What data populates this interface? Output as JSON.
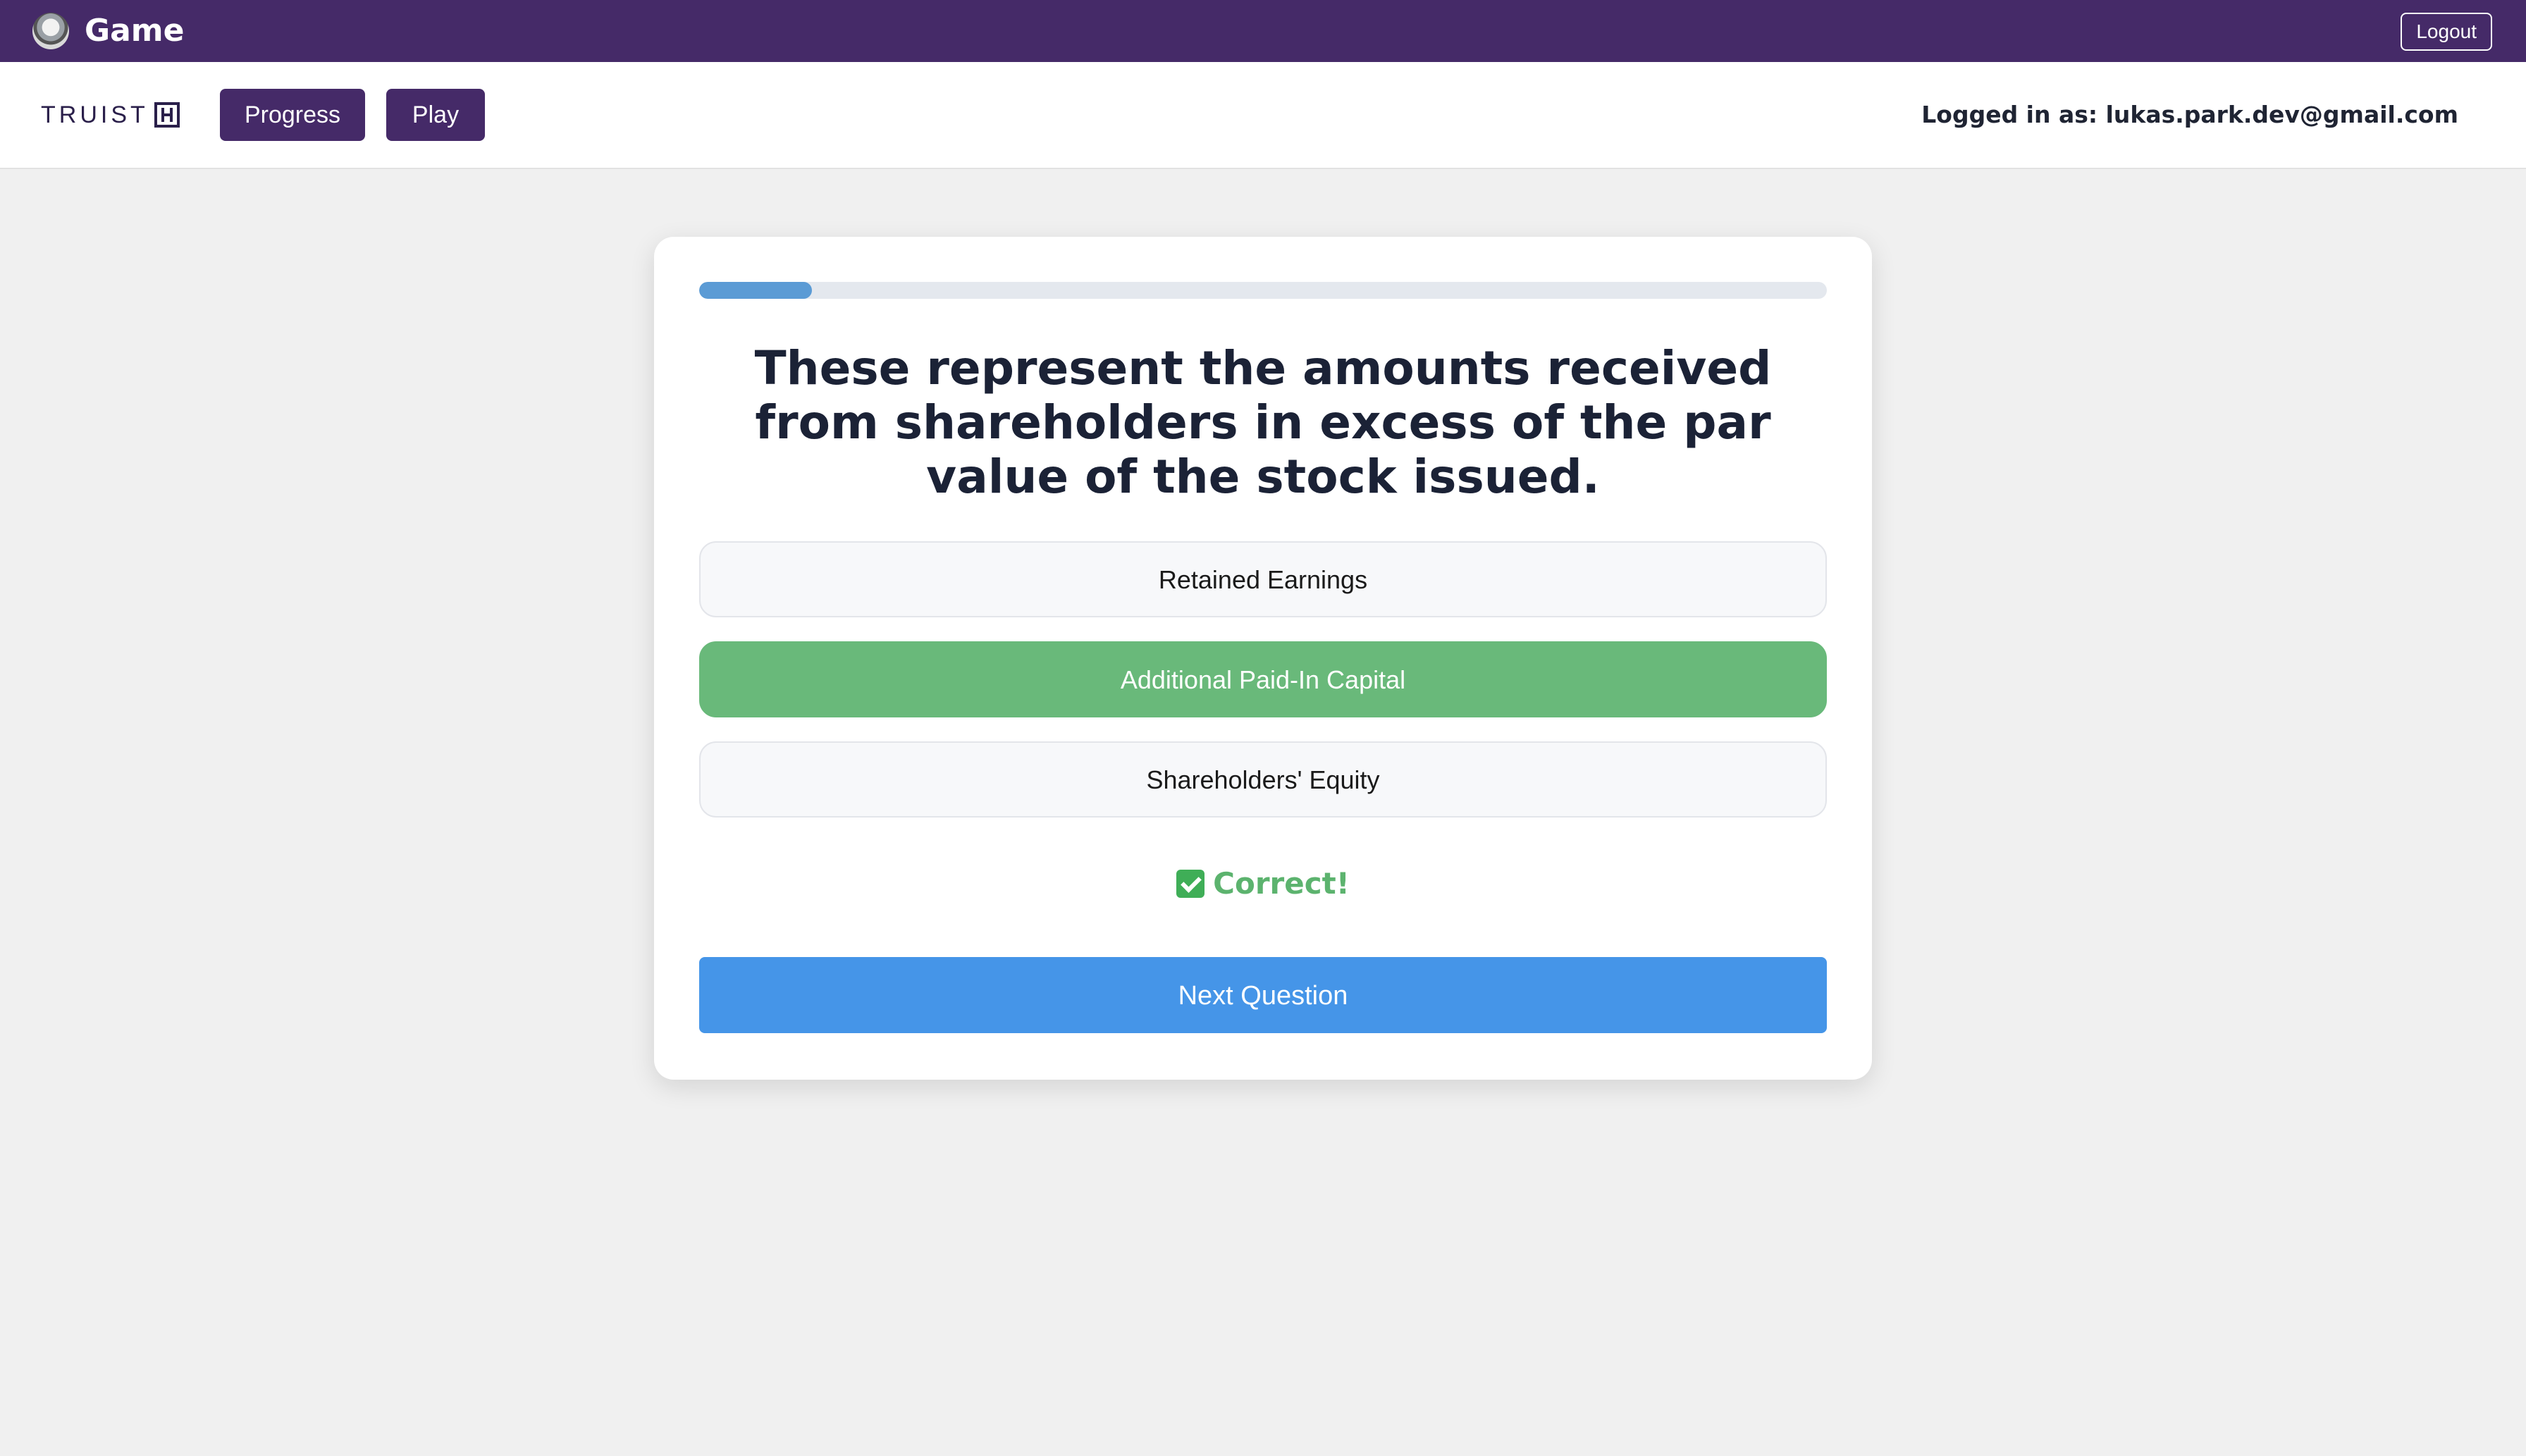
{
  "topbar": {
    "logo_icon": "globe-logo-icon",
    "title": "Game",
    "logout_label": "Logout"
  },
  "navbar": {
    "brand_text": "TRUIST",
    "brand_icon": "truist-mark-icon",
    "progress_label": "Progress",
    "play_label": "Play",
    "user_info": "Logged in as: lukas.park.dev@gmail.com"
  },
  "quiz": {
    "progress_fraction": 0.1,
    "question": "These represent the amounts received from shareholders in excess of the par value of the stock issued.",
    "answers": [
      {
        "label": "Retained Earnings",
        "state": "default"
      },
      {
        "label": "Additional Paid-In Capital",
        "state": "correct"
      },
      {
        "label": "Shareholders' Equity",
        "state": "default"
      }
    ],
    "feedback_icon": "check-mark-icon",
    "feedback": "Correct!",
    "next_label": "Next Question"
  },
  "colors": {
    "topbar_bg": "#452a68",
    "correct": "#69b97a",
    "primary_button": "#4595e8",
    "progress_fill": "#5b9bd5"
  }
}
